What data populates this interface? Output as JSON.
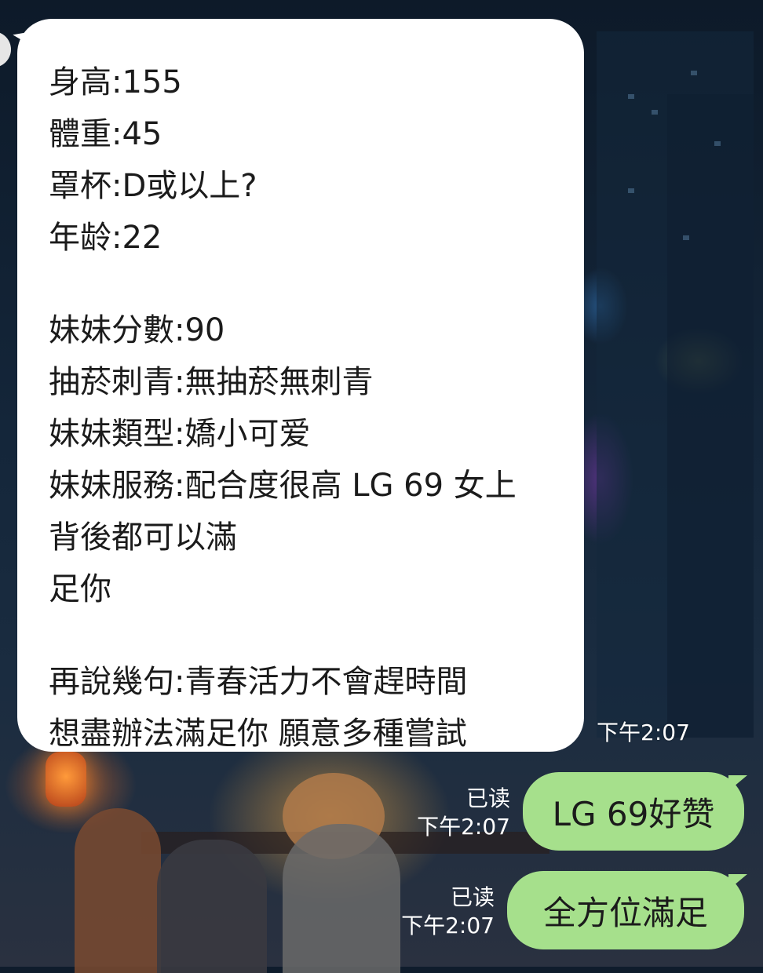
{
  "incoming_message": {
    "lines": [
      "身高:155",
      "體重:45",
      "罩杯:D或以上?",
      "年龄:22",
      "",
      "妹妹分數:90",
      "抽菸刺青:無抽菸無刺青",
      "妹妹類型:嬌小可爱",
      "妹妹服務:配合度很高 LG 69 女上",
      "背後都可以滿",
      "足你",
      "",
      "再說幾句:青春活力不會趕時間",
      "想盡辦法滿足你 願意多種嘗試"
    ],
    "time": "下午2:07"
  },
  "outgoing_messages": [
    {
      "text": "LG 69好赞",
      "read_label": "已读",
      "time": "下午2:07"
    },
    {
      "text": "全方位滿足",
      "read_label": "已读",
      "time": "下午2:07"
    }
  ],
  "colors": {
    "incoming_bubble": "#ffffff",
    "outgoing_bubble": "#a6e08c",
    "background": "#0f1c2c"
  }
}
